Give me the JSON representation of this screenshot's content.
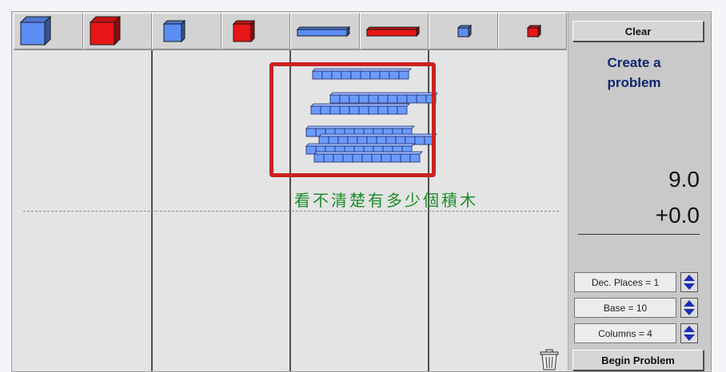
{
  "toolbar": {
    "items": [
      {
        "name": "tool-blue-cube-icon",
        "color": "#5b8ef5",
        "kind": "cube"
      },
      {
        "name": "tool-red-cube-icon",
        "color": "#e81616",
        "kind": "cube"
      },
      {
        "name": "tool-blue-flat-icon",
        "color": "#5b8ef5",
        "kind": "flat"
      },
      {
        "name": "tool-red-flat-icon",
        "color": "#e81616",
        "kind": "flat"
      },
      {
        "name": "tool-blue-long-icon",
        "color": "#5b8ef5",
        "kind": "long"
      },
      {
        "name": "tool-red-long-icon",
        "color": "#e81616",
        "kind": "long"
      },
      {
        "name": "tool-blue-unit-icon",
        "color": "#5b8ef5",
        "kind": "unit"
      },
      {
        "name": "tool-red-unit-icon",
        "color": "#e81616",
        "kind": "unit"
      }
    ]
  },
  "sidebar": {
    "clear_label": "Clear",
    "title_line1": "Create a",
    "title_line2": "problem",
    "number1": "9.0",
    "number2": "+0.0",
    "dec_places_label": "Dec. Places = 1",
    "base_label": "Base = 10",
    "columns_label": "Columns = 4",
    "begin_label": "Begin Problem"
  },
  "annotation": {
    "text": "看不清楚有多少個積木"
  },
  "colors": {
    "block_blue": "#6b9bff",
    "block_red": "#e81616",
    "annotation_frame": "#cc2121",
    "annotation_text": "#1d8c2a"
  }
}
